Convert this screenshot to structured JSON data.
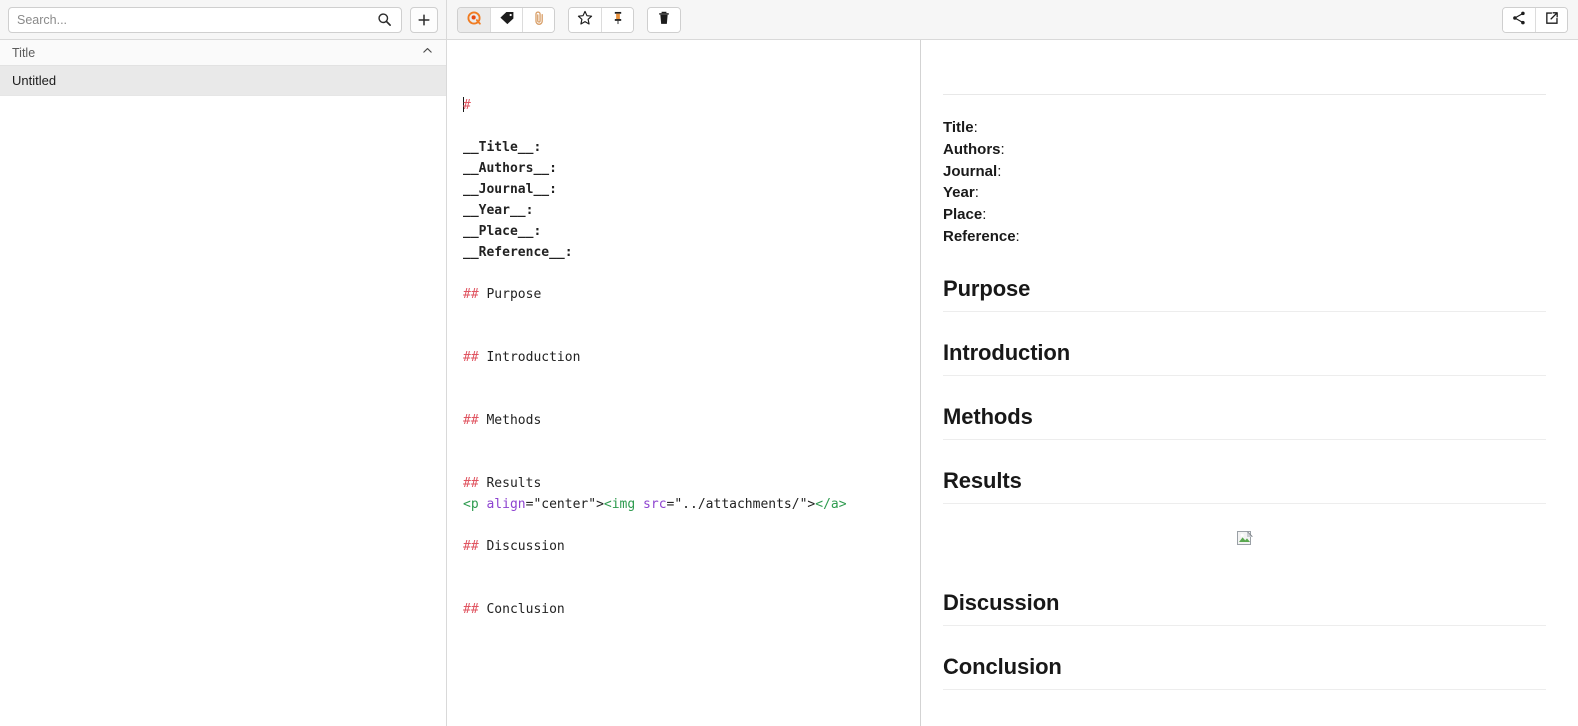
{
  "app": {
    "accent_color": "#f07c22",
    "editor_hash_color": "#e05561",
    "editor_tag_color": "#2e9b4f",
    "editor_attr_color": "#8e44d0"
  },
  "search": {
    "placeholder": "Search...",
    "value": "",
    "search_icon": "search-icon",
    "new_note_icon": "plus-icon",
    "new_note_label": "+"
  },
  "toolbar": {
    "groups": [
      {
        "name": "view-group",
        "buttons": [
          {
            "name": "toggle-preview-button",
            "icon": "eye-icon",
            "active": true
          },
          {
            "name": "tags-button",
            "icon": "tag-icon",
            "active": false
          },
          {
            "name": "attachments-button",
            "icon": "paperclip-icon",
            "active": false
          }
        ]
      },
      {
        "name": "mark-group",
        "buttons": [
          {
            "name": "favorite-button",
            "icon": "star-icon",
            "active": false
          },
          {
            "name": "pin-button",
            "icon": "pin-icon",
            "active": false
          }
        ]
      },
      {
        "name": "delete-group",
        "buttons": [
          {
            "name": "delete-button",
            "icon": "trash-icon",
            "active": false
          }
        ]
      }
    ],
    "right_buttons": [
      {
        "name": "share-button",
        "icon": "share-icon"
      },
      {
        "name": "open-external-button",
        "icon": "external-link-icon"
      }
    ]
  },
  "sidebar": {
    "column_header": "Title",
    "collapse_icon": "chevron-up-icon",
    "items": [
      {
        "title": "Untitled",
        "selected": true
      }
    ]
  },
  "editor": {
    "lines": [
      {
        "type": "heading1",
        "hash": "#",
        "text": "",
        "caret": true
      },
      {
        "type": "blank"
      },
      {
        "type": "bold",
        "text": "__Title__:"
      },
      {
        "type": "bold",
        "text": "__Authors__:"
      },
      {
        "type": "bold",
        "text": "__Journal__:"
      },
      {
        "type": "bold",
        "text": "__Year__:"
      },
      {
        "type": "bold",
        "text": "__Place__:"
      },
      {
        "type": "bold",
        "text": "__Reference__:"
      },
      {
        "type": "blank"
      },
      {
        "type": "heading2",
        "hash": "##",
        "text": " Purpose"
      },
      {
        "type": "blank"
      },
      {
        "type": "blank"
      },
      {
        "type": "heading2",
        "hash": "##",
        "text": " Introduction"
      },
      {
        "type": "blank"
      },
      {
        "type": "blank"
      },
      {
        "type": "heading2",
        "hash": "##",
        "text": " Methods"
      },
      {
        "type": "blank"
      },
      {
        "type": "blank"
      },
      {
        "type": "heading2",
        "hash": "##",
        "text": " Results"
      },
      {
        "type": "html",
        "parts": [
          {
            "color": "tag",
            "text": "<p"
          },
          {
            "color": "plain",
            "text": " "
          },
          {
            "color": "attr",
            "text": "align"
          },
          {
            "color": "plain",
            "text": "=\"center\">"
          },
          {
            "color": "tag",
            "text": "<img"
          },
          {
            "color": "plain",
            "text": " "
          },
          {
            "color": "attr",
            "text": "src"
          },
          {
            "color": "plain",
            "text": "=\"../attachments/\">"
          },
          {
            "color": "tag",
            "text": "</a>"
          }
        ]
      },
      {
        "type": "blank"
      },
      {
        "type": "heading2",
        "hash": "##",
        "text": " Discussion"
      },
      {
        "type": "blank"
      },
      {
        "type": "blank"
      },
      {
        "type": "heading2",
        "hash": "##",
        "text": " Conclusion"
      }
    ]
  },
  "preview": {
    "title_rule": true,
    "meta": [
      {
        "label": "Title",
        "colon": ":"
      },
      {
        "label": "Authors",
        "colon": ":"
      },
      {
        "label": "Journal",
        "colon": ":"
      },
      {
        "label": "Year",
        "colon": ":"
      },
      {
        "label": "Place",
        "colon": ":"
      },
      {
        "label": "Reference",
        "colon": ":"
      }
    ],
    "sections": [
      {
        "heading": "Purpose",
        "has_image": false
      },
      {
        "heading": "Introduction",
        "has_image": false
      },
      {
        "heading": "Methods",
        "has_image": false
      },
      {
        "heading": "Results",
        "has_image": true,
        "image_alt": "broken-image-icon"
      },
      {
        "heading": "Discussion",
        "has_image": false
      },
      {
        "heading": "Conclusion",
        "has_image": false
      }
    ]
  }
}
